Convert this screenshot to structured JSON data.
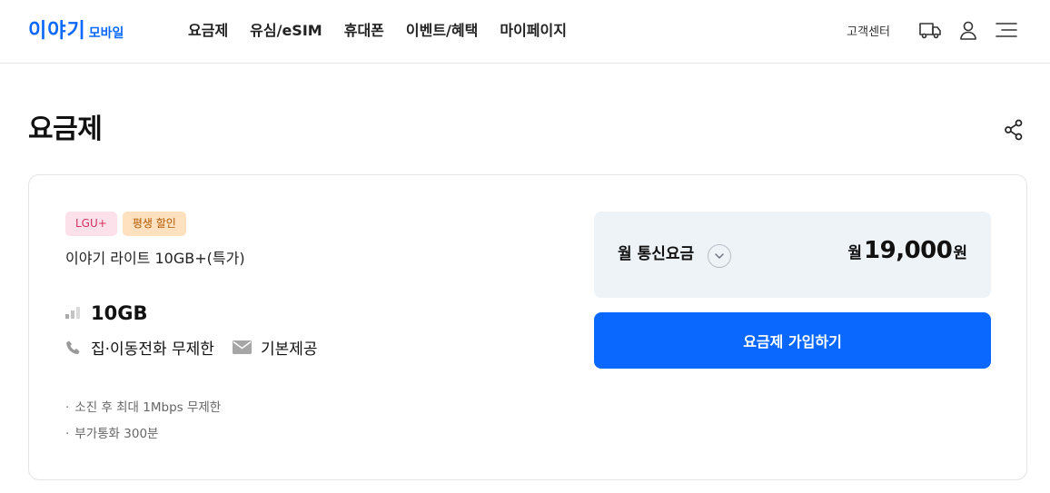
{
  "header": {
    "logo": "이야기",
    "logo_sub": "모바일",
    "nav": [
      "요금제",
      "유심/eSIM",
      "휴대폰",
      "이벤트/혜택",
      "마이페이지"
    ],
    "customer_center": "고객센터",
    "icons": [
      "delivery-truck-icon",
      "user-icon",
      "hamburger-menu-icon"
    ]
  },
  "page": {
    "title": "요금제"
  },
  "plan": {
    "badges": {
      "carrier": "LGU+",
      "discount": "평생 할인"
    },
    "name": "이야기 라이트 10GB+(특가)",
    "data": "10GB",
    "call": "집·이동전화 무제한",
    "sms": "기본제공",
    "notes": [
      "소진 후 최대 1Mbps 무제한",
      "부가통화 300분"
    ]
  },
  "pricing": {
    "label": "월 통신요금",
    "prefix": "월",
    "amount": "19,000",
    "suffix": "원"
  },
  "cta": {
    "join_label": "요금제 가입하기"
  },
  "colors": {
    "brand": "#0a68ff",
    "carrier_badge_bg": "#fde1ea",
    "discount_badge_bg": "#ffe0bf",
    "price_box_bg": "#eef3f8"
  }
}
